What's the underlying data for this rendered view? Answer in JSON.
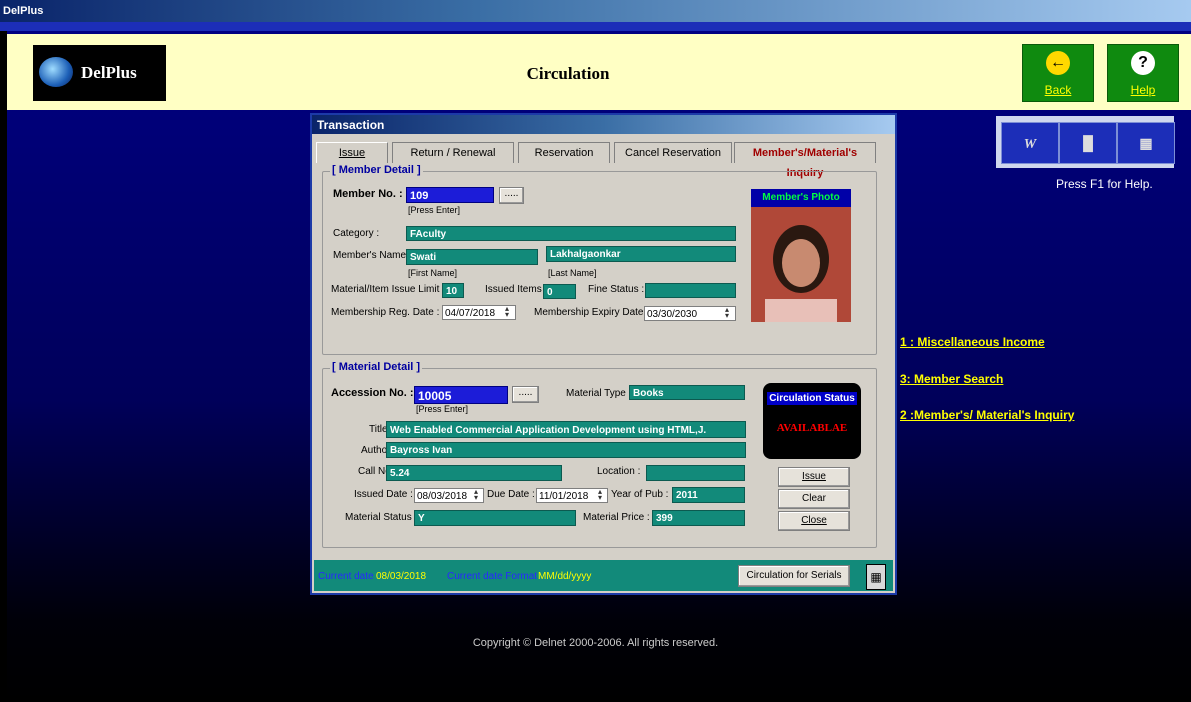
{
  "window": {
    "title": "DelPlus"
  },
  "header": {
    "logo_text": "DelPlus",
    "page_title": "Circulation",
    "back_label": "Back",
    "help_label": "Help"
  },
  "tools": {
    "word_label": "W",
    "f1_hint": "Press F1 for Help."
  },
  "side_links": [
    "1 : Miscellaneous Income",
    "3: Member Search",
    "2 :Member's/ Material's Inquiry"
  ],
  "dialog": {
    "title": "Transaction",
    "tabs": [
      "Issue",
      "Return / Renewal",
      "Reservation",
      "Cancel Reservation",
      "Member's/Material's Inquiry"
    ],
    "member": {
      "group_label": "[ Member Detail ]",
      "member_no_label": "Member No. :",
      "member_no": "109",
      "press_enter": "[Press Enter]",
      "lookup_label": ".....",
      "category_label": "Category :",
      "category": "FAculty",
      "name_label": "Member's Name:",
      "first_name": "Swati",
      "last_name": "Lakhalgaonkar",
      "first_name_hint": "[First Name]",
      "last_name_hint": "[Last Name]",
      "issue_limit_label": "Material/Item Issue Limit :",
      "issue_limit": "10",
      "issued_items_label": "Issued Items :",
      "issued_items": "0",
      "fine_status_label": "Fine Status :",
      "fine_status": "",
      "reg_date_label": "Membership Reg. Date :",
      "reg_date": "04/07/2018",
      "expiry_date_label": "Membership Expiry Date :",
      "expiry_date": "03/30/2030",
      "photo_label": "Member's Photo"
    },
    "material": {
      "group_label": "[ Material Detail ]",
      "accession_label": "Accession No. :",
      "accession_no": "10005",
      "press_enter": "[Press Enter]",
      "lookup_label": ".....",
      "material_type_label": "Material Type :",
      "material_type": "Books",
      "title_label": "Title :",
      "title": "Web Enabled Commercial Application Development using HTML,J.",
      "author_label": "Author :",
      "author": "Bayross Ivan",
      "call_no_label": "Call No. :",
      "call_no": "5.24",
      "location_label": "Location :",
      "location": "",
      "issued_date_label": "Issued Date :",
      "issued_date": "08/03/2018",
      "due_date_label": "Due Date :",
      "due_date": "11/01/2018",
      "year_label": "Year of Pub :",
      "year": "2011",
      "status_label": "Material Status :",
      "status": "Y",
      "price_label": "Material Price :",
      "price": "399",
      "circ_status_label": "Circulation Status",
      "circ_status": "AVAILABLAE"
    },
    "buttons": {
      "issue": "Issue",
      "clear": "Clear",
      "close": "Close"
    },
    "footer": {
      "current_date_label": "Current date",
      "current_date": "08/03/2018",
      "date_format_label": "Current date Format",
      "date_format": "MM/dd/yyyy",
      "serials_button": "Circulation for Serials"
    }
  },
  "copyright": "Copyright © Delnet 2000-2006. All rights reserved.",
  "colors": {
    "header_bg": "#ffffc4",
    "field_teal": "#128a7a",
    "field_blue": "#1c1cd8",
    "link_yellow": "#ffff00",
    "status_red": "#ff0000"
  }
}
